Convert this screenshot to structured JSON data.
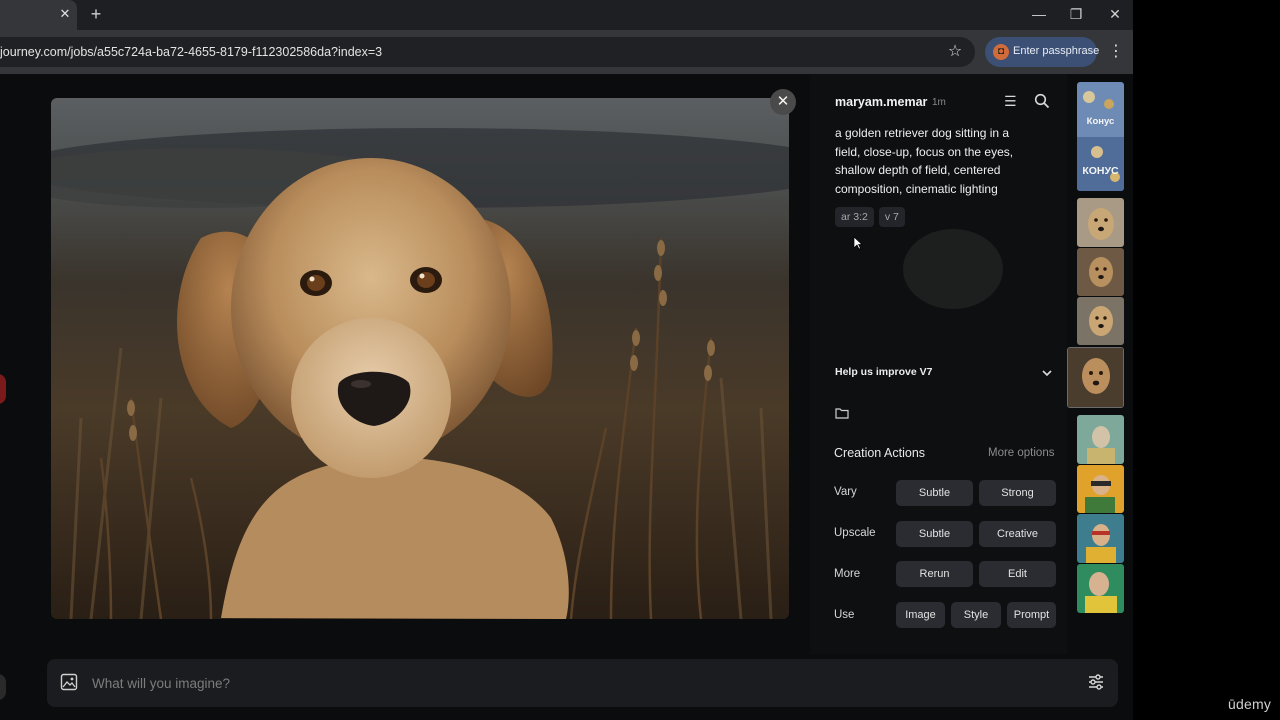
{
  "browser": {
    "tab_close": "✕",
    "new_tab": "+",
    "url": "journey.com/jobs/a55c724a-ba72-4655-8179-f112302586da?index=3",
    "passphrase_label": "Enter passphrase",
    "window_minimize": "—",
    "window_restore": "❐",
    "window_close": "✕"
  },
  "viewer": {
    "close": "✕"
  },
  "panel": {
    "author": "maryam.memar",
    "time_ago": "1m",
    "prompt": "a golden retriever dog sitting in a field, close-up, focus on the eyes, shallow depth of field, centered composition, cinematic lighting",
    "params": [
      "ar 3:2",
      "v 7"
    ],
    "help_label": "Help us improve V7",
    "creation_actions": {
      "title": "Creation Actions",
      "more_options": "More options",
      "rows": [
        {
          "label": "Vary",
          "buttons": [
            "Subtle",
            "Strong"
          ]
        },
        {
          "label": "Upscale",
          "buttons": [
            "Subtle",
            "Creative"
          ]
        },
        {
          "label": "More",
          "buttons": [
            "Rerun",
            "Edit"
          ]
        },
        {
          "label": "Use",
          "buttons": [
            "Image",
            "Style",
            "Prompt"
          ]
        }
      ]
    }
  },
  "thumbnails": {
    "text_1": "Конус",
    "text_2": "КОНУС"
  },
  "imagine": {
    "placeholder": "What will you imagine?"
  },
  "watermark": "ūdemy"
}
